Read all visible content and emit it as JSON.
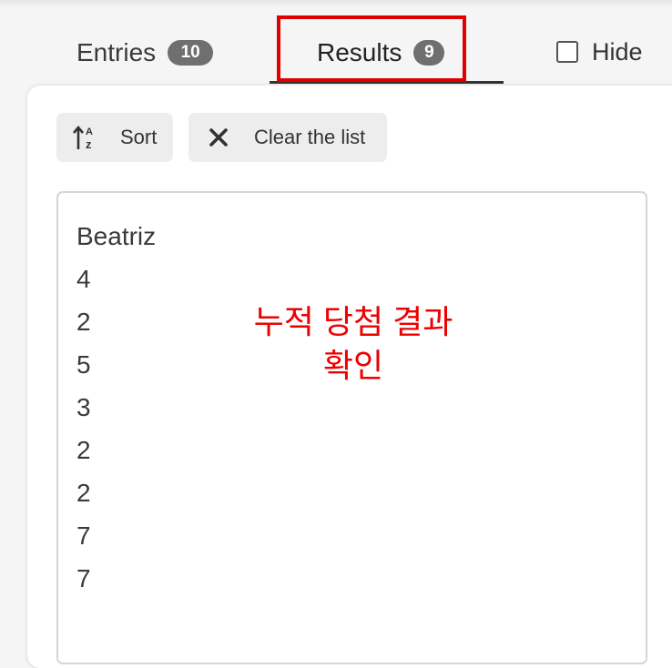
{
  "tabs": {
    "entries": {
      "label": "Entries",
      "count": "10"
    },
    "results": {
      "label": "Results",
      "count": "9",
      "active": true
    },
    "hide_label": "Hide"
  },
  "toolbar": {
    "sort_label": "Sort",
    "clear_label": "Clear the list",
    "sort_icon": "sort-az-icon",
    "clear_icon": "close-icon"
  },
  "results": {
    "items": [
      "Beatriz",
      "4",
      "2",
      "5",
      "3",
      "2",
      "2",
      "7",
      "7"
    ]
  },
  "annotation": {
    "line1": "누적 당첨 결과",
    "line2": "확인",
    "color": "#ee0000"
  },
  "colors": {
    "badge": "#6f6f6f",
    "highlight": "#e00000",
    "button_bg": "#ededed"
  }
}
